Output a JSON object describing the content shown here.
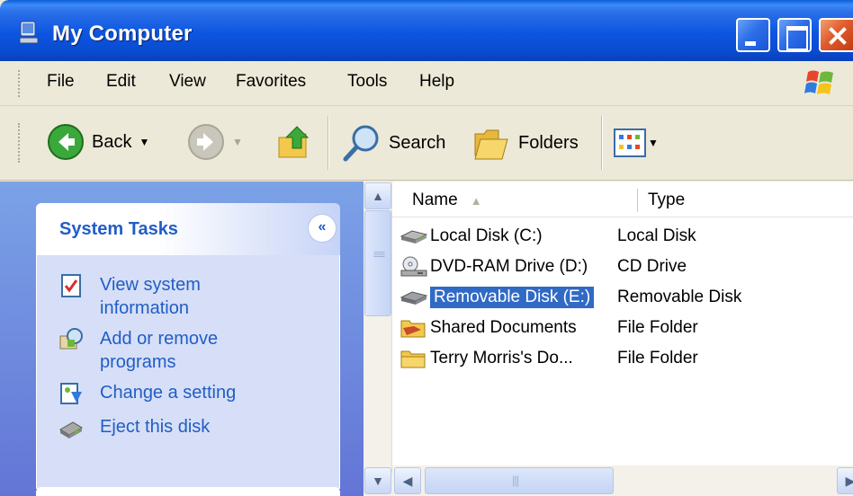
{
  "window": {
    "title": "My Computer"
  },
  "menu": [
    "File",
    "Edit",
    "View",
    "Favorites",
    "Tools",
    "Help"
  ],
  "toolbar": {
    "back_label": "Back",
    "search_label": "Search",
    "folders_label": "Folders"
  },
  "system_tasks": {
    "title": "System Tasks",
    "collapse_glyph": "«",
    "items": [
      {
        "label": "View system information",
        "icon": "system-info-icon"
      },
      {
        "label": "Add or remove programs",
        "icon": "add-remove-icon"
      },
      {
        "label": "Change a setting",
        "icon": "control-panel-icon"
      },
      {
        "label": "Eject this disk",
        "icon": "eject-disk-icon"
      }
    ]
  },
  "file_list": {
    "columns": {
      "name": "Name",
      "type": "Type"
    },
    "rows": [
      {
        "name": "Local Disk (C:)",
        "type": "Local Disk",
        "icon": "hard-disk-icon"
      },
      {
        "name": "DVD-RAM Drive (D:)",
        "type": "CD Drive",
        "icon": "dvd-drive-icon"
      },
      {
        "name": "Removable Disk (E:)",
        "type": "Removable Disk",
        "icon": "removable-disk-icon",
        "selected": true
      },
      {
        "name": "Shared Documents",
        "type": "File Folder",
        "icon": "shared-folder-icon"
      },
      {
        "name": "Terry Morris's Do...",
        "type": "File Folder",
        "icon": "folder-icon"
      }
    ]
  },
  "colors": {
    "title_blue": "#0a55e0",
    "task_link": "#215dc6",
    "selection": "#316ac5"
  }
}
